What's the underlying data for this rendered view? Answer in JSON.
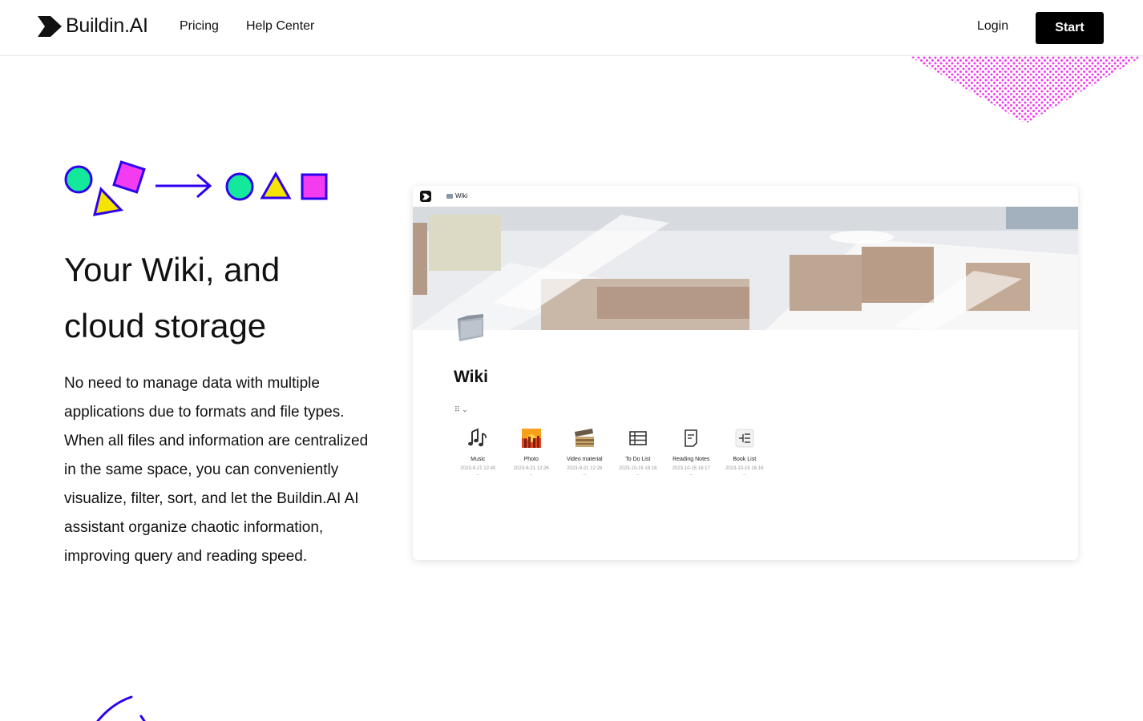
{
  "header": {
    "brand": "Buildin.AI",
    "nav": [
      {
        "label": "Pricing"
      },
      {
        "label": "Help Center"
      }
    ],
    "login_label": "Login",
    "start_label": "Start"
  },
  "hero": {
    "title_line1": "Your Wiki, and",
    "title_line2": "cloud storage",
    "description": "No need to manage data with multiple applications due to formats and file types. When all files and information are centralized in the same space, you can conveniently visualize, filter, sort, and let the Buildin.AI AI assistant organize chaotic information, improving query and reading speed."
  },
  "preview": {
    "breadcrumb": "Wiki",
    "page_title": "Wiki",
    "view_switch": "⠿ ⌄",
    "items": [
      {
        "name": "Music",
        "date": "2023-9-21 12:40",
        "dash": "–",
        "icon": "music-notes-icon"
      },
      {
        "name": "Photo",
        "date": "2023-9-21 12:26",
        "dash": "–",
        "icon": "sunset-photo-icon"
      },
      {
        "name": "Video material",
        "date": "2023-9-21 12:26",
        "dash": "–",
        "icon": "film-clapper-icon"
      },
      {
        "name": "To Do List",
        "date": "2023-10-15 16:18",
        "dash": "–",
        "icon": "table-icon"
      },
      {
        "name": "Reading Notes",
        "date": "2023-10-15 16:17",
        "dash": "–",
        "icon": "document-icon"
      },
      {
        "name": "Book List",
        "date": "2023-10-15 16:16",
        "dash": "–",
        "icon": "list-icon"
      }
    ]
  },
  "colors": {
    "accent_green": "#14e89a",
    "accent_purple": "#2d00f0",
    "accent_magenta": "#f33cf0",
    "accent_yellow": "#f5e400",
    "button_black": "#000000"
  }
}
